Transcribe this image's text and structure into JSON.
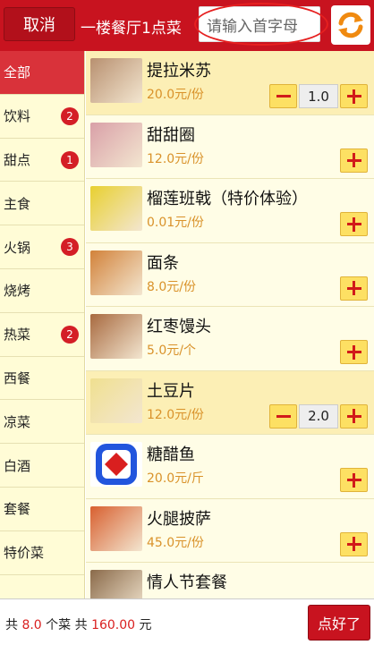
{
  "header": {
    "cancel_label": "取消",
    "title": "一楼餐厅1点菜",
    "search_placeholder": "请输入首字母"
  },
  "categories": [
    {
      "label": "全部",
      "badge": ""
    },
    {
      "label": "饮料",
      "badge": "2"
    },
    {
      "label": "甜点",
      "badge": "1"
    },
    {
      "label": "主食",
      "badge": ""
    },
    {
      "label": "火锅",
      "badge": "3"
    },
    {
      "label": "烧烤",
      "badge": ""
    },
    {
      "label": "热菜",
      "badge": "2"
    },
    {
      "label": "西餐",
      "badge": ""
    },
    {
      "label": "凉菜",
      "badge": ""
    },
    {
      "label": "白酒",
      "badge": ""
    },
    {
      "label": "套餐",
      "badge": ""
    },
    {
      "label": "特价菜",
      "badge": ""
    }
  ],
  "items": [
    {
      "name": "提拉米苏",
      "price": "20.0元/份",
      "qty": "1.0",
      "thumb": "tiramisu",
      "color": "#b89070"
    },
    {
      "name": "甜甜圈",
      "price": "12.0元/份",
      "qty": "",
      "thumb": "donut",
      "color": "#d9a0a8"
    },
    {
      "name": "榴莲班戟（特价体验）",
      "price": "0.01元/份",
      "qty": "",
      "thumb": "durian",
      "color": "#e8d030"
    },
    {
      "name": "面条",
      "price": "8.0元/份",
      "qty": "",
      "thumb": "noodles",
      "color": "#d2823a"
    },
    {
      "name": "红枣馒头",
      "price": "5.0元/个",
      "qty": "",
      "thumb": "buns",
      "color": "#a86a40"
    },
    {
      "name": "土豆片",
      "price": "12.0元/份",
      "qty": "2.0",
      "thumb": "potato",
      "color": "#f0e090"
    },
    {
      "name": "糖醋鱼",
      "price": "20.0元/斤",
      "qty": "",
      "thumb": "fish-logo",
      "color": "#2255dd"
    },
    {
      "name": "火腿披萨",
      "price": "45.0元/份",
      "qty": "",
      "thumb": "pizza",
      "color": "#d86030"
    },
    {
      "name": "情人节套餐",
      "price": "",
      "qty": "",
      "thumb": "set-meal",
      "color": "#8a6a4a"
    }
  ],
  "footer": {
    "prefix": "共",
    "count": "8.0",
    "mid": "个菜 共",
    "total": "160.00",
    "suffix": "元",
    "order_label": "点好了"
  }
}
